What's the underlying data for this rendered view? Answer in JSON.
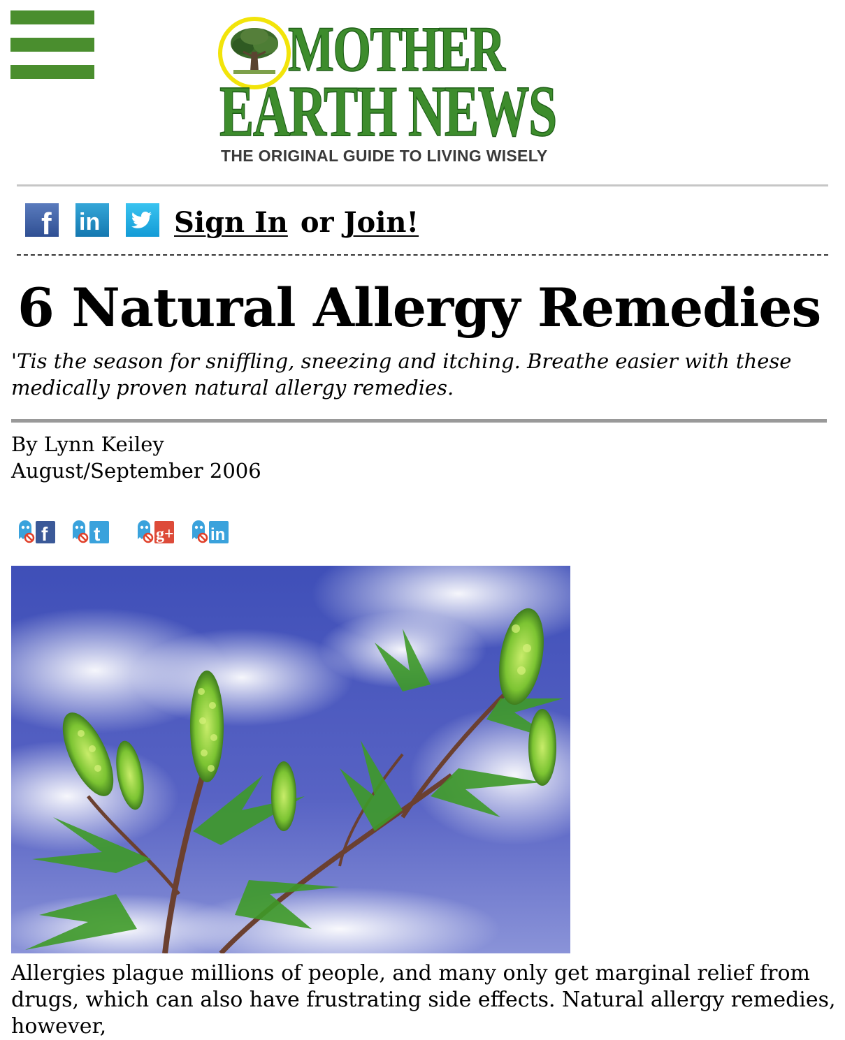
{
  "logo": {
    "line1": "MOTHER",
    "line2": "EARTH NEWS",
    "tagline": "THE ORIGINAL GUIDE TO LIVING WISELY"
  },
  "social": {
    "facebook_icon": "facebook-icon",
    "linkedin_icon": "linkedin-icon",
    "twitter_icon": "twitter-icon",
    "facebook_glyph": "f",
    "linkedin_glyph": "in"
  },
  "auth": {
    "sign_in": "Sign In",
    "or": "or",
    "join": "Join!"
  },
  "article": {
    "title": "6 Natural Allergy Remedies",
    "subtitle": "'Tis the season for sniffling, sneezing and itching. Breathe easier with these medically proven natural allergy remedies.",
    "byline": "By Lynn Keiley",
    "date": "August/September 2006",
    "body_start": "Allergies plague millions of people, and many only get marginal relief from drugs, which can also have frustrating side effects. Natural allergy remedies, however,"
  },
  "share": {
    "facebook_glyph": "f",
    "twitter_glyph": "t",
    "googleplus_glyph": "g+",
    "linkedin_glyph": "in"
  },
  "colors": {
    "brand_green": "#3d8c2c",
    "menu_green": "#4a8e2e",
    "logo_ring_yellow": "#f2e40a",
    "share_blue": "#3aa2dc",
    "googleplus_red": "#dd4b39"
  }
}
